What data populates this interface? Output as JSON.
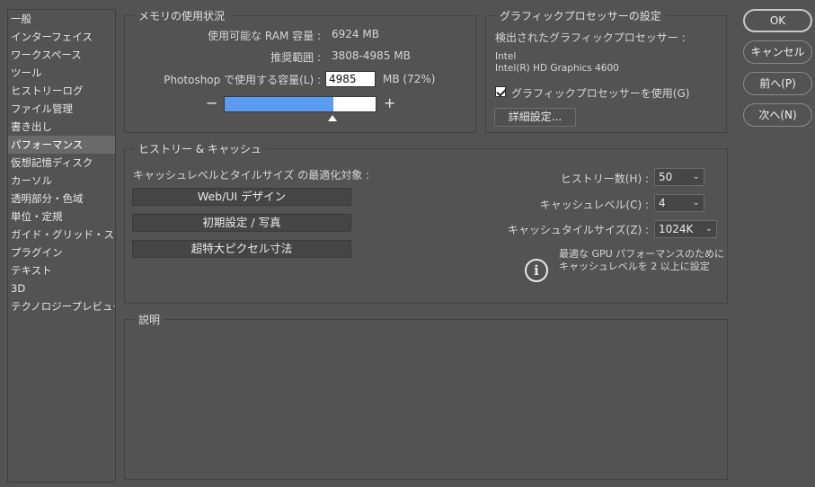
{
  "sidebar": {
    "items": [
      {
        "label": "一般"
      },
      {
        "label": "インターフェイス"
      },
      {
        "label": "ワークスペース"
      },
      {
        "label": "ツール"
      },
      {
        "label": "ヒストリーログ"
      },
      {
        "label": "ファイル管理"
      },
      {
        "label": "書き出し"
      },
      {
        "label": "パフォーマンス",
        "selected": true
      },
      {
        "label": "仮想記憶ディスク"
      },
      {
        "label": "カーソル"
      },
      {
        "label": "透明部分・色域"
      },
      {
        "label": "単位・定規"
      },
      {
        "label": "ガイド・グリッド・スライス"
      },
      {
        "label": "プラグイン"
      },
      {
        "label": "テキスト"
      },
      {
        "label": "3D"
      },
      {
        "label": "テクノロジープレビュー"
      }
    ]
  },
  "memory": {
    "title": "メモリの使用状況",
    "available_label": "使用可能な RAM 容量 :",
    "available_value": "6924 MB",
    "range_label": "推奨範囲 :",
    "range_value": "3808-4985 MB",
    "usage_label": "Photoshop で使用する容量(L) :",
    "usage_value": "4985",
    "usage_unit": "MB (72%)",
    "slider_fraction": 0.72,
    "minus": "−",
    "plus": "+"
  },
  "gpu": {
    "title": "グラフィックプロセッサーの設定",
    "detected_label": "検出されたグラフィックプロセッサー :",
    "vendor": "Intel",
    "model": "Intel(R) HD Graphics 4600",
    "use_gpu_label": "グラフィックプロセッサーを使用(G)",
    "use_gpu_checked": true,
    "advanced_button": "詳細設定..."
  },
  "history_cache": {
    "title": "ヒストリー & キャッシュ",
    "optimize_label": "キャッシュレベルとタイルサイズ の最適化対象 :",
    "preset_buttons": [
      "Web/UI デザイン",
      "初期設定 / 写真",
      "超特大ピクセル寸法"
    ],
    "history_states_label": "ヒストリー数(H) :",
    "history_states_value": "50",
    "cache_levels_label": "キャッシュレベル(C) :",
    "cache_levels_value": "4",
    "cache_tile_label": "キャッシュタイルサイズ(Z) :",
    "cache_tile_value": "1024K",
    "info_line1": "最適な GPU パフォーマンスのために",
    "info_line2": "キャッシュレベルを 2 以上に設定"
  },
  "description": {
    "title": "説明"
  },
  "buttons": {
    "ok": "OK",
    "cancel": "キャンセル",
    "prev": "前へ(P)",
    "next": "次へ(N)"
  },
  "colors": {
    "background": "#535353",
    "slider_fill": "#5b9bf0"
  },
  "icons": {
    "info": "info-icon",
    "dropdown": "chevron-down-icon",
    "checkbox": "checkmark-icon"
  }
}
